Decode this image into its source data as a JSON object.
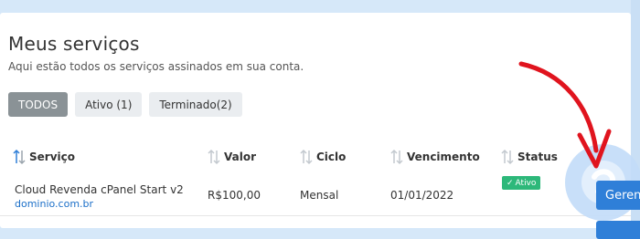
{
  "header": {
    "title": "Meus serviços",
    "subtitle": "Aqui estão todos os serviços assinados em sua conta."
  },
  "filters": [
    {
      "label": "TODOS",
      "active": true
    },
    {
      "label": "Ativo (1)",
      "active": false
    },
    {
      "label": "Terminado(2)",
      "active": false
    }
  ],
  "table": {
    "columns": [
      "Serviço",
      "Valor",
      "Ciclo",
      "Vencimento",
      "Status"
    ],
    "rows": [
      {
        "service": "Cloud Revenda cPanel Start v2",
        "domain": "dominio.com.br",
        "value": "R$100,00",
        "cycle": "Mensal",
        "due": "01/01/2022",
        "status": "Ativo",
        "action": "Gerenciar"
      }
    ]
  },
  "colors": {
    "accent": "#2f7fd8",
    "status_active": "#2db87a",
    "filter_active": "#8a9296",
    "annotation_arrow": "#e0141e"
  },
  "icons": [
    "sort-icon",
    "check-icon",
    "arrow-annotation-icon"
  ]
}
